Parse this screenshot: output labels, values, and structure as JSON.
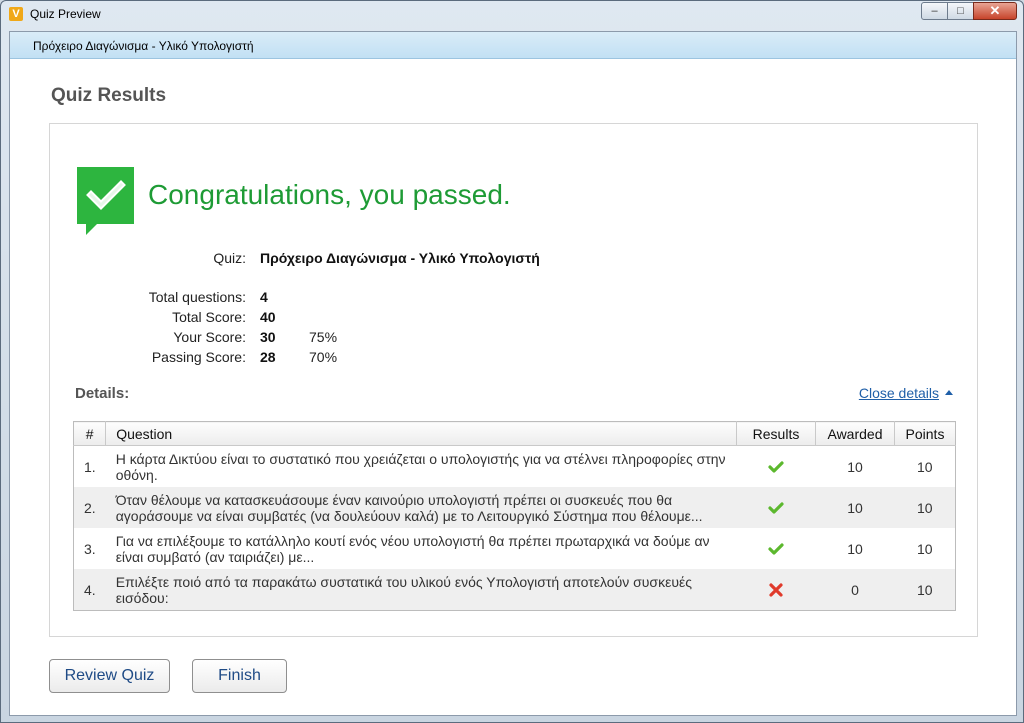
{
  "window": {
    "title": "Quiz Preview",
    "app_icon": "V",
    "controls": {
      "minimize": "–",
      "maximize": "□",
      "close": "✕"
    }
  },
  "subheader": {
    "quiz_name": "Πρόχειρο Διαγώνισμα - Υλικό Υπολογιστή"
  },
  "page": {
    "title": "Quiz Results"
  },
  "result": {
    "message": "Congratulations, you passed.",
    "badge_icon": "check-speech-bubble",
    "badge_color": "#2db53f",
    "message_color": "#1e9b35"
  },
  "summary": {
    "quiz_label": "Quiz:",
    "quiz_value": "Πρόχειρο Διαγώνισμα - Υλικό Υπολογιστή",
    "total_questions_label": "Total questions:",
    "total_questions": "4",
    "total_score_label": "Total Score:",
    "total_score": "40",
    "your_score_label": "Your Score:",
    "your_score": "30",
    "your_score_pct": "75%",
    "passing_score_label": "Passing Score:",
    "passing_score": "28",
    "passing_score_pct": "70%"
  },
  "details": {
    "label": "Details:",
    "toggle_label": "Close details",
    "columns": {
      "num": "#",
      "question": "Question",
      "results": "Results",
      "awarded": "Awarded",
      "points": "Points"
    },
    "rows": [
      {
        "num": "1.",
        "question": "Η κάρτα Δικτύου είναι το συστατικό που χρειάζεται ο υπολογιστής για να στέλνει πληροφορίες στην οθόνη.",
        "result": "correct",
        "awarded": "10",
        "points": "10"
      },
      {
        "num": "2.",
        "question": "Όταν θέλουμε να κατασκευάσουμε έναν καινούριο υπολογιστή πρέπει οι συσκευές που θα αγοράσουμε να είναι συμβατές (να δουλεύουν καλά) με το Λειτουργικό Σύστημα που θέλουμε...",
        "result": "correct",
        "awarded": "10",
        "points": "10"
      },
      {
        "num": "3.",
        "question": "Για να επιλέξουμε το κατάλληλο κουτί ενός νέου υπολογιστή θα πρέπει πρωταρχικά να δούμε αν είναι συμβατό (αν ταιριάζει) με...",
        "result": "correct",
        "awarded": "10",
        "points": "10"
      },
      {
        "num": "4.",
        "question": "Επιλέξτε ποιό από τα παρακάτω συστατικά του υλικού ενός Υπολογιστή αποτελούν συσκευές εισόδου:",
        "result": "incorrect",
        "awarded": "0",
        "points": "10"
      }
    ]
  },
  "buttons": {
    "review": "Review Quiz",
    "finish": "Finish"
  },
  "colors": {
    "correct": "#5cb82e",
    "incorrect": "#e03a2b",
    "link": "#1f5fa8"
  }
}
